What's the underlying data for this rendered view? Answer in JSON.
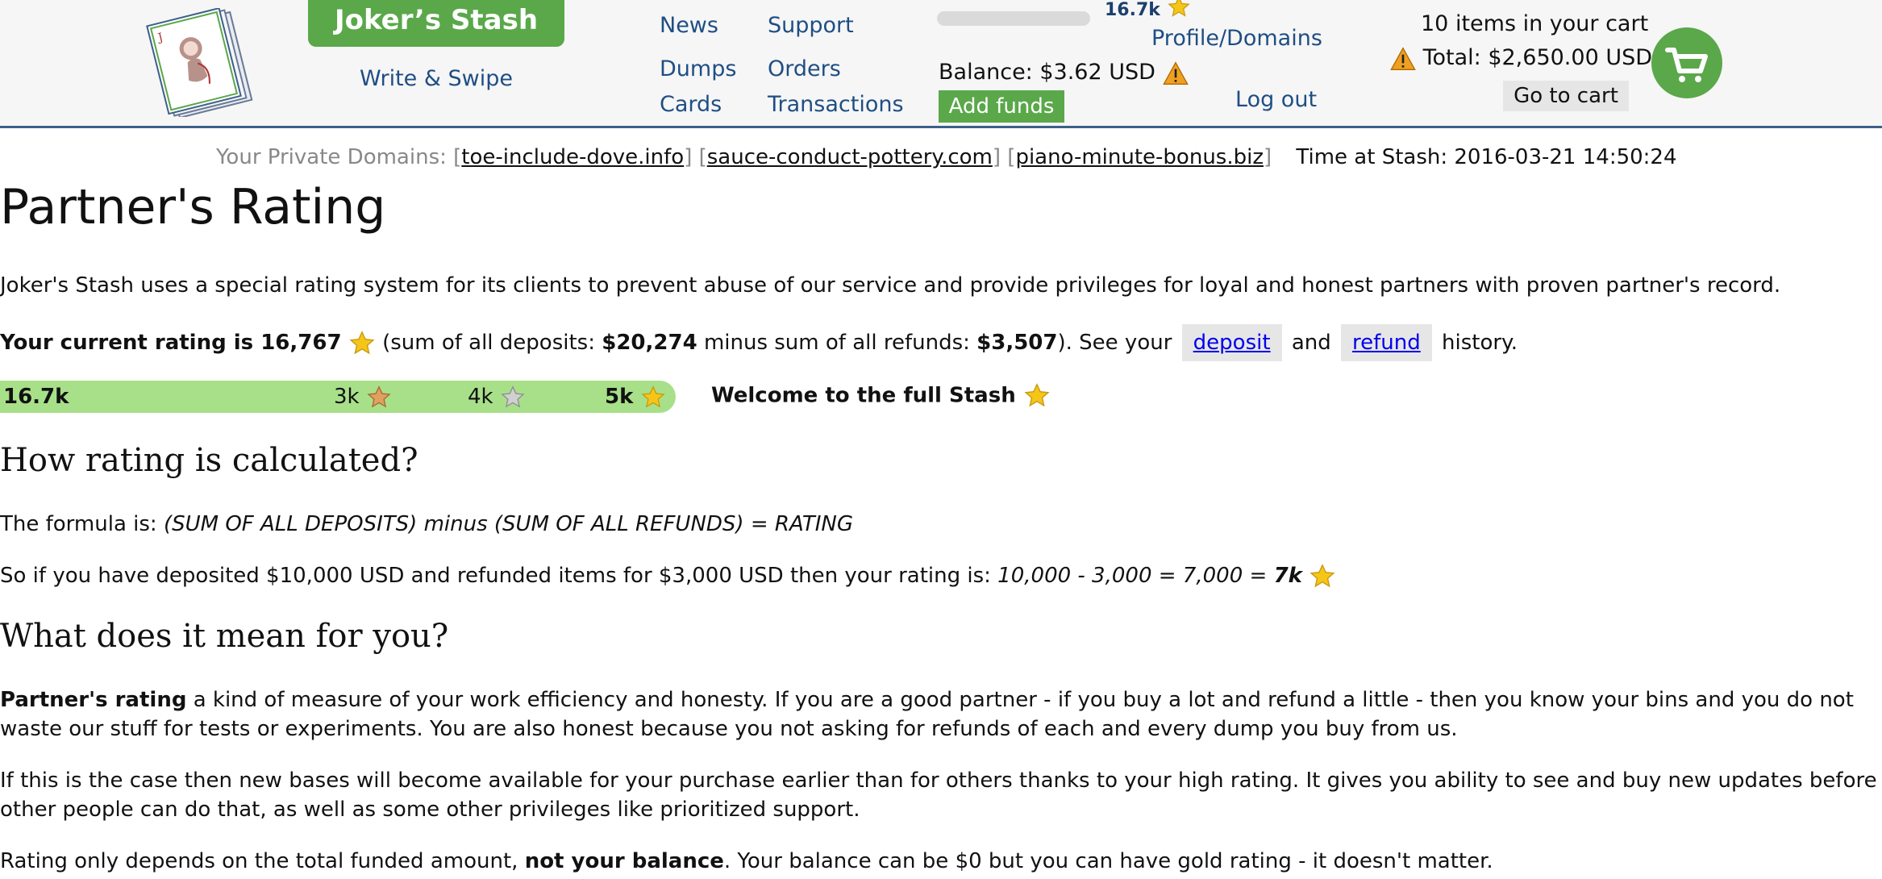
{
  "header": {
    "brand": "Joker’s Stash",
    "write_swipe": "Write & Swipe",
    "nav": {
      "news": "News",
      "support": "Support",
      "dumps": "Dumps",
      "orders": "Orders",
      "cards": "Cards",
      "transactions": "Transactions",
      "profile_domains": "Profile/Domains",
      "logout": "Log out"
    },
    "rating_mini": "16.7k",
    "balance": "Balance: $3.62 USD",
    "add_funds": "Add funds",
    "cart_count": "10 items in your cart",
    "cart_total": "Total: $2,650.00 USD",
    "go_to_cart": "Go to cart"
  },
  "domains": {
    "label": "Your Private Domains:",
    "list": [
      "toe-include-dove.info",
      "sauce-conduct-pottery.com",
      "piano-minute-bonus.biz"
    ],
    "time": "Time at Stash: 2016-03-21 14:50:24"
  },
  "page": {
    "title": "Partner's Rating",
    "intro": "Joker's Stash uses a special rating system for its clients to prevent abuse of our service and provide privileges for loyal and honest partners with proven partner's record.",
    "rating_line": {
      "label": "Your current rating is 16,767",
      "deposits_prefix": "(sum of all deposits:",
      "deposits": "$20,274",
      "refunds_prefix": "minus sum of all refunds:",
      "refunds": "$3,507",
      "see_your": "). See your",
      "deposit": "deposit",
      "and": "and",
      "refund": "refund",
      "history": "history."
    },
    "bar": {
      "current": "16.7k",
      "tier1": "3k",
      "tier2": "4k",
      "tier3": "5k",
      "welcome": "Welcome to the full Stash",
      "progress_fraction": 1.0
    },
    "h2_calc": "How rating is calculated?",
    "formula_prefix": "The formula is:",
    "formula": "(SUM OF ALL DEPOSITS) minus (SUM OF ALL REFUNDS) = RATING",
    "example_prefix": "So if you have deposited $10,000 USD and refunded items for $3,000 USD then your rating is:",
    "example_calc": "10,000 - 3,000 = 7,000 =",
    "example_result": "7k",
    "h2_mean": "What does it mean for you?",
    "p1_bold": "Partner's rating",
    "p1_rest": " a kind of measure of your work efficiency and honesty. If you are a good partner - if you buy a lot and refund a little - then you know your bins and you do not waste our stuff for tests or experiments. You are also honest because you not asking for refunds of each and every dump you buy from us.",
    "p2": "If this is the case then new bases will become available for your purchase earlier than for others thanks to your high rating. It gives you ability to see and buy new updates before other people can do that, as well as some other privileges like prioritized support.",
    "p3_a": "Rating only depends on the total funded amount,",
    "p3_bold": "not your balance",
    "p3_b": ". Your balance can be $0 but you can have gold rating - it doesn't matter."
  },
  "colors": {
    "brand_green": "#5aa84a",
    "link_blue": "#1f4e84",
    "bar_green": "#a8e08a",
    "gold": "#f5c518",
    "bronze": "#e0a060",
    "silver": "#c8c8c8"
  },
  "icons": [
    "logo-icon",
    "star-icon",
    "warning-icon",
    "cart-icon"
  ]
}
